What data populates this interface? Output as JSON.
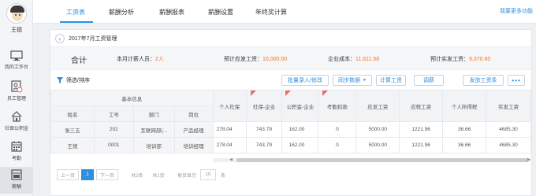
{
  "user": {
    "name": "王德"
  },
  "sidebar": {
    "items": [
      {
        "label": "我的工作台",
        "icon": "monitor-icon"
      },
      {
        "label": "员工管理",
        "icon": "employee-card-icon"
      },
      {
        "label": "社保公积金",
        "icon": "house-icon"
      },
      {
        "label": "考勤",
        "icon": "calendar-icon"
      },
      {
        "label": "薪酬",
        "icon": "salary-icon",
        "active": true
      }
    ]
  },
  "tabs": [
    {
      "label": "工资表",
      "active": true
    },
    {
      "label": "薪酬分析"
    },
    {
      "label": "薪酬报表"
    },
    {
      "label": "薪酬设置"
    },
    {
      "label": "年终奖计算"
    }
  ],
  "more_link": "我要更多功能",
  "breadcrumb": {
    "back": "‹",
    "title": "2017年7月工资管理"
  },
  "summary": {
    "title": "合计",
    "items": [
      {
        "label": "本月计薪人员：",
        "value": "2人"
      },
      {
        "label": "预计应发工资：",
        "value": "10,000.00"
      },
      {
        "label": "企业成本：",
        "value": "11,811.58"
      },
      {
        "label": "预计实发工资：",
        "value": "9,370.60"
      }
    ]
  },
  "toolbar": {
    "filter_label": "筛选/排序",
    "buttons": [
      "批量录入/修改",
      "同步数据",
      "计算工资",
      "调薪",
      "发放工资条",
      "•••"
    ]
  },
  "table": {
    "group_header": "基本信息",
    "frozen_headers": [
      "姓名",
      "工号",
      "部门",
      "岗位"
    ],
    "headers": [
      "个人社保",
      "社保-企业",
      "公积金-企业",
      "考勤扣款",
      "应发工资",
      "应税工资",
      "个人所得税",
      "实发工资"
    ],
    "rows": [
      {
        "frozen": [
          "张三五",
          "202",
          "互联网部(...",
          "产品经理"
        ],
        "cells": [
          "278.04",
          "743.79",
          "162.00",
          "0",
          "5000.00",
          "1221.96",
          "36.66",
          "4685.30"
        ]
      },
      {
        "frozen": [
          "王德",
          "0001",
          "培训部",
          "培训经理"
        ],
        "cells": [
          "278.04",
          "743.79",
          "162.00",
          "0",
          "5000.00",
          "1221.96",
          "36.66",
          "4685.30"
        ]
      }
    ]
  },
  "pagination": {
    "prev": "上一页",
    "current": "1",
    "next": "下一页",
    "total_items": "共2条",
    "total_pages": "共1页",
    "per_page_label": "每页显示",
    "per_page_value": "10",
    "per_page_unit": "条"
  },
  "colors": {
    "accent": "#2f8fe0",
    "highlight_value": "#f0762a",
    "flag": "#f06a6a"
  }
}
